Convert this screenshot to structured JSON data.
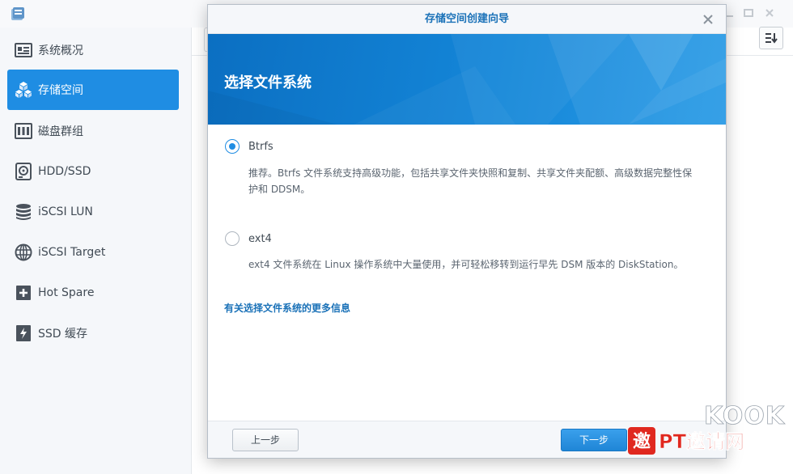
{
  "sidebar": {
    "items": [
      {
        "label": "系统概况",
        "icon": "overview-card-icon",
        "active": false
      },
      {
        "label": "存储空间",
        "icon": "storage-cubes-icon",
        "active": true
      },
      {
        "label": "磁盘群组",
        "icon": "disk-group-icon",
        "active": false
      },
      {
        "label": "HDD/SSD",
        "icon": "hard-disk-icon",
        "active": false
      },
      {
        "label": "iSCSI LUN",
        "icon": "database-stack-icon",
        "active": false
      },
      {
        "label": "iSCSI Target",
        "icon": "globe-icon",
        "active": false
      },
      {
        "label": "Hot Spare",
        "icon": "plus-box-icon",
        "active": false
      },
      {
        "label": "SSD 缓存",
        "icon": "ssd-cache-icon",
        "active": false
      }
    ]
  },
  "dialog": {
    "title": "存储空间创建向导",
    "banner_title": "选择文件系统",
    "options": [
      {
        "label": "Btrfs",
        "selected": true,
        "description_line1": "推荐。Btrfs 文件系统支持高级功能，包括共享文件夹快照和复制、共享文件夹配额、高级数据完整性保",
        "description_line2": "护和 DDSM。"
      },
      {
        "label": "ext4",
        "selected": false,
        "description_line1": "ext4 文件系统在 Linux 操作系统中大量使用，并可轻松移转到运行早先 DSM 版本的 DiskStation。"
      }
    ],
    "more_info_link": "有关选择文件系统的更多信息",
    "prev_button": "上一步",
    "next_button": "下一步"
  },
  "watermark": {
    "brand": "KOOK",
    "text": "PT邀请网"
  },
  "colors": {
    "accent": "#1f8de3",
    "banner": "#1486d8",
    "link": "#1b72b8",
    "watermark_red": "#e0281f"
  }
}
